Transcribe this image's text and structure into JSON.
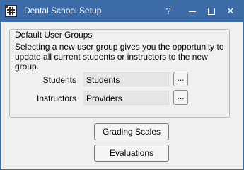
{
  "window": {
    "title": "Dental School Setup",
    "icon": "grid-app-icon",
    "controls": {
      "help": "?",
      "minimize": "minimize",
      "maximize": "maximize",
      "close": "✕"
    }
  },
  "group": {
    "title": "Default User Groups",
    "description": "Selecting a new user group gives you the opportunity to update all current students or instructors to the new group.",
    "rows": [
      {
        "label": "Students",
        "value": "Students",
        "button": "..."
      },
      {
        "label": "Instructors",
        "value": "Providers",
        "button": "..."
      }
    ]
  },
  "buttons": {
    "grading_scales": "Grading Scales",
    "evaluations": "Evaluations"
  },
  "colors": {
    "titlebar": "#3d6ba8",
    "background": "#f0f0f0",
    "field": "#e6e6e6"
  }
}
